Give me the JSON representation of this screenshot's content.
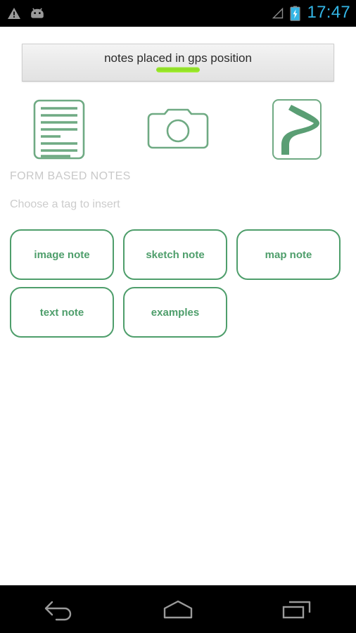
{
  "statusbar": {
    "left_icons": [
      {
        "name": "warning-triangle-icon",
        "glyph": "warning"
      },
      {
        "name": "android-robot-icon",
        "glyph": "android"
      }
    ],
    "right_icons": [
      {
        "name": "signal-triangle-icon",
        "glyph": "signal-empty"
      },
      {
        "name": "battery-charging-icon",
        "glyph": "battery-charging"
      }
    ],
    "clock": "17:47",
    "accent_color": "#33b5e5",
    "background_color": "#000000"
  },
  "titlebar": {
    "title": "notes placed in gps position",
    "indicator_color": "#8ede22"
  },
  "quick_icons": [
    {
      "name": "text-note-icon",
      "label": "text note"
    },
    {
      "name": "camera-note-icon",
      "label": "image note"
    },
    {
      "name": "sketch-path-note-icon",
      "label": "sketch note"
    }
  ],
  "form_section": {
    "heading": "FORM BASED NOTES",
    "subtitle": "Choose a tag to insert",
    "tags": [
      {
        "label": "image note"
      },
      {
        "label": "sketch note"
      },
      {
        "label": "map note"
      },
      {
        "label": "text note"
      },
      {
        "label": "examples"
      }
    ]
  },
  "navbar": {
    "buttons": [
      {
        "name": "nav-back-button",
        "glyph": "back"
      },
      {
        "name": "nav-home-button",
        "glyph": "home"
      },
      {
        "name": "nav-recents-button",
        "glyph": "recents"
      }
    ]
  },
  "theme": {
    "green": "#4e9e6b",
    "icon_green": "#6faa83",
    "background": "#ffffff",
    "muted_text": "#c9c9c9"
  }
}
